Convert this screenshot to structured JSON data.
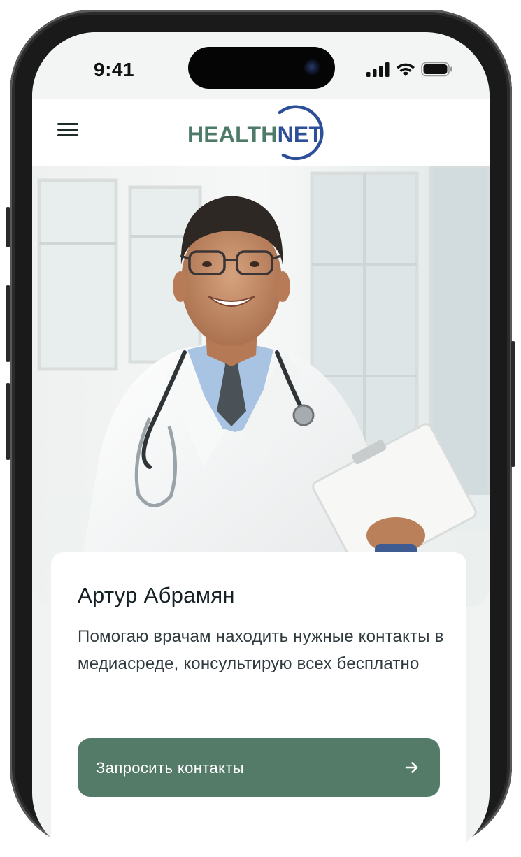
{
  "status_bar": {
    "time": "9:41"
  },
  "brand": {
    "part1": "HEALTH",
    "part2": "NET"
  },
  "profile": {
    "name": "Артур Абрамян",
    "bio": "Помогаю врачам находить нужные контакты в медиасреде, консультирую всех бесплатно"
  },
  "cta": {
    "label": "Запросить контакты",
    "icon": "arrow-right-icon"
  },
  "colors": {
    "accent": "#547b68",
    "logo_green": "#4e7a68",
    "logo_blue": "#2d4f98",
    "screen_bg": "#f1f3f2",
    "card_bg": "#ffffff"
  }
}
